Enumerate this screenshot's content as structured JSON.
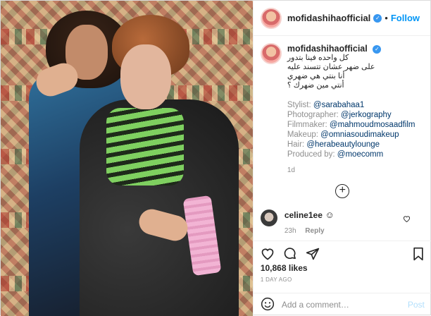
{
  "header": {
    "username": "mofidashihaofficial",
    "separator": "•",
    "follow_label": "Follow"
  },
  "caption": {
    "username": "mofidashihaofficial",
    "arabic_lines": [
      "كل واحده فينا بتدور",
      "على ضهر عشان تتسند عليه",
      "أنا بنتي هي ضهري",
      "أنتي مين ضهرك ؟"
    ],
    "credits": [
      {
        "key": "Stylist: ",
        "value": "@sarabahaa1"
      },
      {
        "key": "Photographer: ",
        "value": "@jerkography"
      },
      {
        "key": "Filmmaker: ",
        "value": "@mahmoudmosaadfilm"
      },
      {
        "key": "Makeup: ",
        "value": "@omniasoudimakeup"
      },
      {
        "key": "Hair: ",
        "value": "@herabeautylounge"
      },
      {
        "key": "Produced by: ",
        "value": "@moecomm"
      }
    ],
    "time": "1d"
  },
  "load_more_glyph": "+",
  "comment": {
    "username": "celine1ee",
    "emoji": "☺",
    "time": "23h",
    "reply_label": "Reply"
  },
  "likes": "10,868 likes",
  "posted_ago": "1 DAY AGO",
  "add_comment": {
    "placeholder": "Add a comment…",
    "post_label": "Post"
  },
  "colors": {
    "accent": "#0095f6",
    "verified": "#3897f0",
    "post_disabled": "#b2dffc"
  },
  "icons": [
    "verified-badge-icon",
    "heart-icon",
    "comment-icon",
    "share-icon",
    "save-icon",
    "emoji-icon",
    "small-heart-icon",
    "add-circle-icon"
  ]
}
